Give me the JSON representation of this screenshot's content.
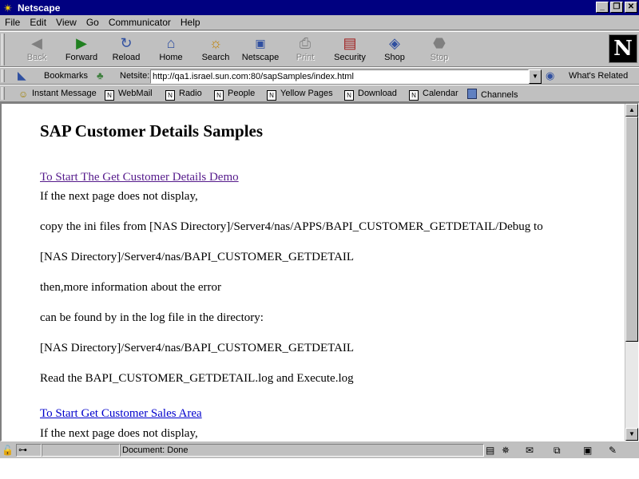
{
  "window": {
    "title": "Netscape"
  },
  "menu": [
    "File",
    "Edit",
    "View",
    "Go",
    "Communicator",
    "Help"
  ],
  "nav": {
    "back": "Back",
    "forward": "Forward",
    "reload": "Reload",
    "home": "Home",
    "search": "Search",
    "netscape": "Netscape",
    "print": "Print",
    "security": "Security",
    "shop": "Shop",
    "stop": "Stop"
  },
  "location": {
    "bookmarks": "Bookmarks",
    "label": "Netsite:",
    "url": "http://qa1.israel.sun.com:80/sapSamples/index.html",
    "related": "What's Related"
  },
  "personal": [
    "Instant Message",
    "WebMail",
    "Radio",
    "People",
    "Yellow Pages",
    "Download",
    "Calendar",
    "Channels"
  ],
  "page": {
    "heading": "SAP Customer Details Samples",
    "link1": "To Start The Get Customer Details Demo",
    "lines": [
      "If the next page does not display,",
      "copy the ini files from [NAS Directory]/Server4/nas/APPS/BAPI_CUSTOMER_GETDETAIL/Debug to",
      "[NAS Directory]/Server4/nas/BAPI_CUSTOMER_GETDETAIL",
      "then,more information about the error",
      "can be found by in the log file in the directory:",
      "[NAS Directory]/Server4/nas/BAPI_CUSTOMER_GETDETAIL",
      "Read the BAPI_CUSTOMER_GETDETAIL.log and Execute.log"
    ],
    "link2": "To Start Get Customer Sales Area",
    "line_after": "If the next page does not display,"
  },
  "status": {
    "text": "Document: Done"
  },
  "icons": {
    "app": "netscape-star-icon",
    "back": "back-arrow-icon",
    "forward": "forward-arrow-icon",
    "reload": "reload-icon",
    "home": "home-icon",
    "search": "search-icon",
    "netscape": "netscape-icon",
    "print": "printer-icon",
    "security": "padlock-icon",
    "shop": "shop-bag-icon",
    "stop": "stop-icon"
  }
}
